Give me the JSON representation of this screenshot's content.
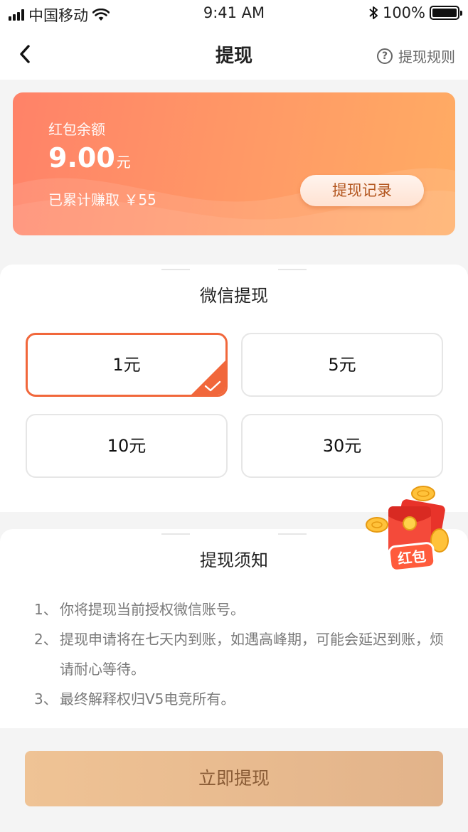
{
  "status_bar": {
    "carrier": "中国移动",
    "time": "9:41 AM",
    "battery": "100%"
  },
  "nav": {
    "title": "提现",
    "rules_label": "提现规则"
  },
  "balance": {
    "label": "红包余额",
    "amount": "9.00",
    "unit": "元",
    "earned": "已累计赚取 ￥55",
    "history_button": "提现记录"
  },
  "withdraw": {
    "title": "微信提现",
    "options": [
      {
        "label": "1元",
        "selected": true
      },
      {
        "label": "5元",
        "selected": false
      },
      {
        "label": "10元",
        "selected": false
      },
      {
        "label": "30元",
        "selected": false
      }
    ]
  },
  "notice": {
    "title": "提现须知",
    "items": [
      {
        "num": "1、",
        "text": "你将提现当前授权微信账号。"
      },
      {
        "num": "2、",
        "text": "提现申请将在七天内到账，如遇高峰期，可能会延迟到账，烦请耐心等待。"
      },
      {
        "num": "3、",
        "text": "最终解释权归V5电竞所有。"
      }
    ]
  },
  "red_packet_label": "红包",
  "submit_button": "立即提现",
  "colors": {
    "accent": "#f1673b",
    "card_start": "#ff8268",
    "card_end": "#ffac63",
    "button": "#e9bb90"
  }
}
